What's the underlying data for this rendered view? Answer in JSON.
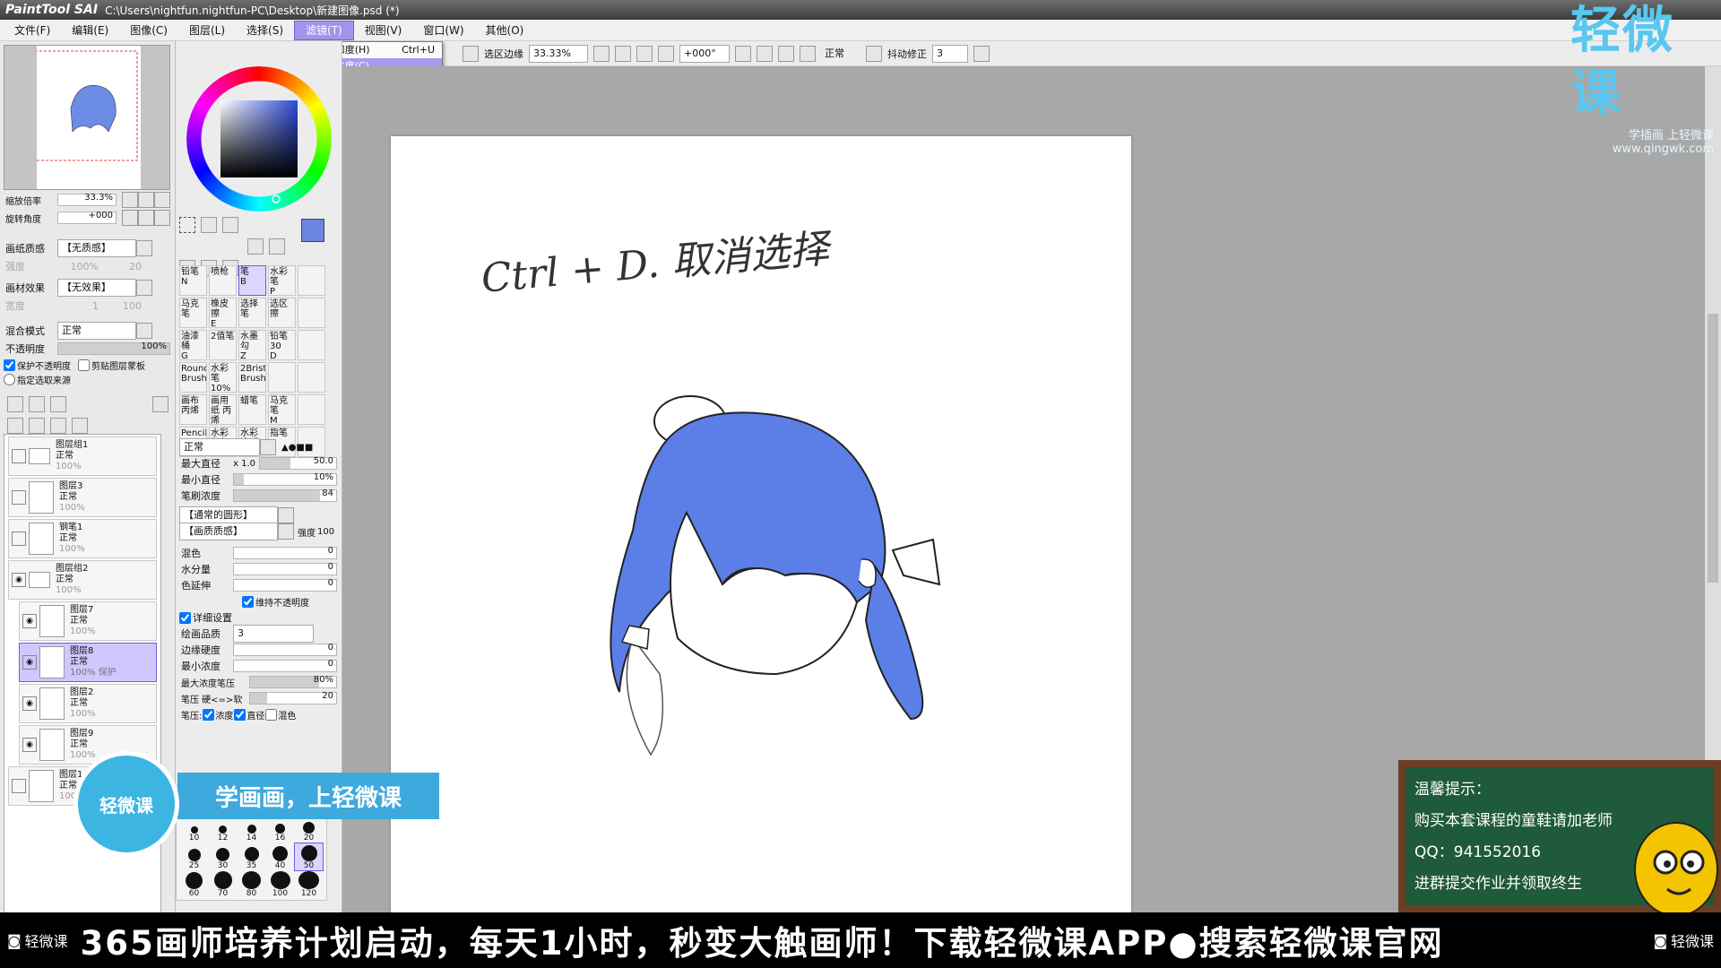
{
  "title_bar": {
    "app": "PaintTool SAI",
    "path": "C:\\Users\\nightfun.nightfun-PC\\Desktop\\新建图像.psd (*)"
  },
  "menu": [
    "文件(F)",
    "编辑(E)",
    "图像(C)",
    "图层(L)",
    "选择(S)",
    "滤镜(T)",
    "视图(V)",
    "窗口(W)",
    "其他(O)"
  ],
  "filter_menu": {
    "hue_sat": "色相/饱和度(H)",
    "hue_sat_shortcut": "Ctrl+U",
    "brightness": "亮度/对比度(C)"
  },
  "toolbar": {
    "select_edge": "选区边缘",
    "zoom": "33.33%",
    "angle": "+000°",
    "mode": "正常",
    "stab_label": "抖动修正",
    "stab_value": "3"
  },
  "navigator": {
    "zoom_label": "缩放倍率",
    "zoom_value": "33.3%",
    "rotate_label": "旋转角度",
    "rotate_value": "+000"
  },
  "paper": {
    "texture_label": "画纸质感",
    "texture_value": "【无质感】",
    "effect_label": "画材效果",
    "effect_value": "【无效果】",
    "strength_label": "强度",
    "strength_value": "100%",
    "scale_label": "倍率",
    "scale_value": "20",
    "width_label": "宽度",
    "width_value": "1",
    "strength2_label": "强度",
    "strength2_value": "100"
  },
  "layer_props": {
    "blend_label": "混合模式",
    "blend_value": "正常",
    "opacity_label": "不透明度",
    "opacity_value": "100%",
    "preserve_opacity": "保护不透明度",
    "clip_group": "剪贴图层蒙板",
    "selection_source": "指定选取来源"
  },
  "layers": [
    {
      "name": "图层组1",
      "mode": "正常",
      "opacity": "100%"
    },
    {
      "name": "图层3",
      "mode": "正常",
      "opacity": "100%"
    },
    {
      "name": "钢笔1",
      "mode": "正常",
      "opacity": "100%"
    },
    {
      "name": "图层组2",
      "mode": "正常",
      "opacity": "100%"
    },
    {
      "name": "图层7",
      "mode": "正常",
      "opacity": "100%"
    },
    {
      "name": "图层8",
      "mode": "正常",
      "opacity": "100% 保护"
    },
    {
      "name": "图层2",
      "mode": "正常",
      "opacity": "100%"
    },
    {
      "name": "图层9",
      "mode": "正常",
      "opacity": "100%"
    },
    {
      "name": "图层1",
      "mode": "正常",
      "opacity": "100%"
    }
  ],
  "brushes": [
    {
      "name": "铅笔",
      "key": "N"
    },
    {
      "name": "喷枪",
      "key": ""
    },
    {
      "name": "笔",
      "key": "B"
    },
    {
      "name": "水彩笔",
      "key": "P"
    },
    {
      "name": "",
      "key": ""
    },
    {
      "name": "马克笔",
      "key": ""
    },
    {
      "name": "橡皮擦",
      "key": "E"
    },
    {
      "name": "选择笔",
      "key": ""
    },
    {
      "name": "选区擦",
      "key": ""
    },
    {
      "name": "",
      "key": ""
    },
    {
      "name": "油漆桶",
      "key": "G"
    },
    {
      "name": "2值笔",
      "key": ""
    },
    {
      "name": "水墨勾",
      "key": "Z"
    },
    {
      "name": "铅笔30",
      "key": "D"
    },
    {
      "name": "",
      "key": ""
    },
    {
      "name": "Round Brush",
      "key": ""
    },
    {
      "name": "水彩笔 10%",
      "key": ""
    },
    {
      "name": "2Brist Brush",
      "key": ""
    },
    {
      "name": "",
      "key": ""
    },
    {
      "name": "",
      "key": ""
    },
    {
      "name": "画布 丙烯",
      "key": ""
    },
    {
      "name": "画用纸 丙烯",
      "key": ""
    },
    {
      "name": "蜡笔",
      "key": ""
    },
    {
      "name": "马克笔",
      "key": "M"
    },
    {
      "name": "",
      "key": ""
    },
    {
      "name": "Pencil",
      "key": "W"
    },
    {
      "name": "水彩 润色",
      "key": ""
    },
    {
      "name": "水彩 渗透",
      "key": ""
    },
    {
      "name": "指笔",
      "key": ""
    },
    {
      "name": "",
      "key": ""
    }
  ],
  "brush_settings": {
    "mode": "正常",
    "max_size_label": "最大直径",
    "max_size_mult": "x 1.0",
    "max_size_value": "50.0",
    "min_size_label": "最小直径",
    "min_size_value": "10%",
    "density_label": "笔刷浓度",
    "density_value": "84",
    "shape": "【通常的圆形】",
    "texture": "【画质质感】",
    "strength_label": "强度",
    "strength_value": "100",
    "blend_label": "混色",
    "blend_value": "0",
    "water_label": "水分量",
    "water_value": "0",
    "stretch_label": "色延伸",
    "stretch_value": "0",
    "keep_opacity": "维持不透明度",
    "detail": "详细设置",
    "quality_label": "绘画品质",
    "quality_value": "3",
    "edge_label": "边缘硬度",
    "edge_value": "0",
    "min_density_label": "最小浓度",
    "min_density_value": "0",
    "max_pressure_label": "最大浓度笔压",
    "max_pressure_value": "80%",
    "pressure_hardness_label": "笔压 硬<=>软",
    "pressure_hardness_value": "20",
    "pressure_label": "笔压:",
    "pressure_density": "浓度",
    "pressure_size": "直径",
    "pressure_blend": "混色"
  },
  "brush_sizes": [
    "0.7",
    "0.8",
    "1",
    "1.5",
    "2",
    "10",
    "12",
    "14",
    "16",
    "20",
    "25",
    "30",
    "35",
    "40",
    "50",
    "60",
    "70",
    "80",
    "100",
    "120"
  ],
  "brush_size_radii": [
    1,
    1,
    1,
    1.5,
    2,
    4,
    4.5,
    5,
    5.5,
    6.5,
    7,
    7.5,
    8,
    8.5,
    9,
    9.5,
    10,
    10.5,
    11,
    11.5
  ],
  "canvas_text": "Ctrl + D.  取消选择",
  "colors": {
    "primary": "#6b86e0",
    "menu_highlight": "#9f95ea",
    "hair": "#5b7fe6",
    "ticker_bg": "#000000",
    "badge": "#3db5e3"
  },
  "overlay": {
    "badge_text": "轻微课",
    "banner_text": "学画画，上轻微课",
    "board_lines": [
      "温馨提示：",
      "购买本套课程的童鞋请加老师",
      "QQ：941552016",
      "进群提交作业并领取终生"
    ],
    "ticker_brand": "轻微课",
    "ticker_text": "365画师培养计划启动，每天1小时，秒变大触画师！下载轻微课APP●搜索轻微课官网",
    "watermark_big": "轻微课",
    "watermark_small1": "学插画 上轻微课",
    "watermark_small2": "www.qingwk.com"
  }
}
